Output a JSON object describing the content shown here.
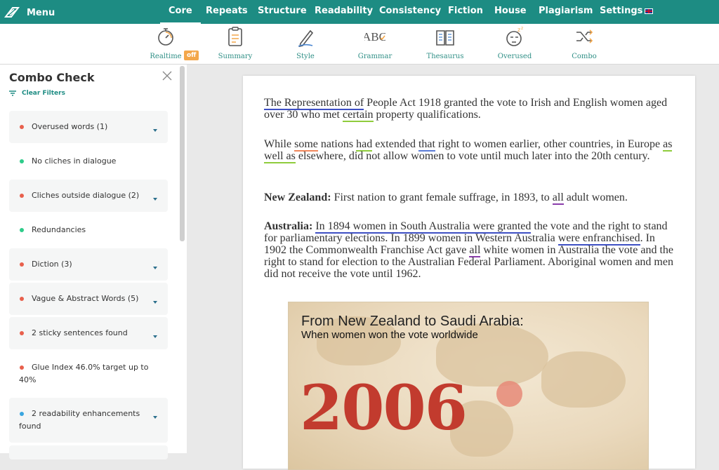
{
  "nav": {
    "menu_label": "Menu",
    "tabs": [
      "Core",
      "Repeats",
      "Structure",
      "Readability",
      "Consistency",
      "Fiction",
      "House",
      "Plagiarism",
      "Settings"
    ],
    "active_tab": "Core"
  },
  "toolbar": {
    "tools": [
      {
        "label": "Realtime",
        "icon": "stopwatch-icon"
      },
      {
        "label": "Summary",
        "icon": "clipboard-icon"
      },
      {
        "label": "Style",
        "icon": "pencil-icon"
      },
      {
        "label": "Grammar",
        "icon": "abc-icon"
      },
      {
        "label": "Thesaurus",
        "icon": "book-icon"
      },
      {
        "label": "Overused",
        "icon": "sleepy-face-icon"
      },
      {
        "label": "Combo",
        "icon": "shuffle-icon"
      }
    ],
    "realtime_badge": "off"
  },
  "sidebar": {
    "title": "Combo Check",
    "clear_filters": "Clear Filters",
    "checks": [
      {
        "label": "Overused words (1)",
        "status": "red",
        "expandable": true
      },
      {
        "label": "No cliches in dialogue",
        "status": "green",
        "expandable": false
      },
      {
        "label": "Cliches outside dialogue (2)",
        "status": "red",
        "expandable": true
      },
      {
        "label": "Redundancies",
        "status": "green",
        "expandable": false
      },
      {
        "label": "Diction (3)",
        "status": "red",
        "expandable": true
      },
      {
        "label": "Vague & Abstract Words (5)",
        "status": "red",
        "expandable": true
      },
      {
        "label": "2 sticky sentences found",
        "status": "red",
        "expandable": true
      },
      {
        "label": "Glue Index 46.0% target up to 40%",
        "status": "red",
        "expandable": false
      },
      {
        "label": "2 readability enhancements found",
        "status": "blue",
        "expandable": true
      }
    ]
  },
  "colors": {
    "brand": "#1d8c83",
    "status_red": "#e8604c",
    "status_green": "#2ecc8a",
    "status_blue": "#3aa6e0",
    "underline_blue": "#3d4fc4",
    "underline_green": "#8fcc3c",
    "underline_orange": "#f0875b",
    "underline_purple": "#8b3dab",
    "year_red": "#c23b2e"
  },
  "document": {
    "p1": {
      "a": "The Representation of",
      "b": " People Act 1918 granted the vote to Irish and English women aged over 30 who met ",
      "c": "certain",
      "d": " property qualifications."
    },
    "p2": {
      "a": "While ",
      "b": "some",
      "c": " nations ",
      "d": "had",
      "e": " extended ",
      "f": "that",
      "g": " right to women earlier, other countries, in Europe ",
      "h": "as well as",
      "i": " elsewhere, did not allow women to vote until much later into the 20th century."
    },
    "p3": {
      "label": "New Zealand:",
      "a": " First nation to grant female suffrage, in 1893, to ",
      "b": "all",
      "c": " adult women."
    },
    "p4": {
      "label": "Australia:",
      "a": " ",
      "b": "In 1894 women in South Australia were granted",
      "c": " the vote and the right to stand for parliamentary elections. In 1899 women in Western Australia ",
      "d": "were enfranchised",
      "e": ". In 1902 the Commonwealth Franchise Act gave ",
      "f": "all",
      "g": " white women in Australia the vote and the right to stand for election to the Australian Federal Parliament. Aboriginal women and men did not receive the vote until 1962."
    },
    "image": {
      "title": "From New Zealand to Saudi Arabia:",
      "subtitle": "When women won the vote worldwide",
      "year": "2006"
    }
  }
}
